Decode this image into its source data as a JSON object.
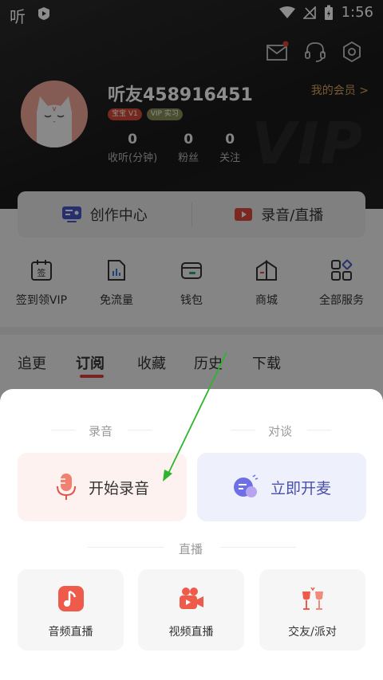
{
  "status_bar": {
    "app_glyph": "听",
    "time": "1:56"
  },
  "profile": {
    "username": "听友458916451",
    "badges": [
      "宝宝 V1",
      "VIP 实习"
    ],
    "member_link": "我的会员 >",
    "stats": [
      {
        "value": "0",
        "label": "收听(分钟)"
      },
      {
        "value": "0",
        "label": "粉丝"
      },
      {
        "value": "0",
        "label": "关注"
      }
    ]
  },
  "watermark": "VIP",
  "creator": {
    "left_label": "创作中心",
    "right_label": "录音/直播"
  },
  "quick_actions": [
    {
      "label": "签到领VIP",
      "icon": "sign-in-icon"
    },
    {
      "label": "免流量",
      "icon": "free-data-icon"
    },
    {
      "label": "钱包",
      "icon": "wallet-icon"
    },
    {
      "label": "商城",
      "icon": "mall-icon"
    },
    {
      "label": "全部服务",
      "icon": "all-services-icon"
    }
  ],
  "tabs": [
    "追更",
    "订阅",
    "收藏",
    "历史",
    "下载"
  ],
  "active_tab": "订阅",
  "sheet": {
    "record_section": "录音",
    "talk_section": "对谈",
    "record_button": "开始录音",
    "talk_button": "立即开麦",
    "live_section": "直播",
    "live_options": [
      {
        "label": "音频直播",
        "icon": "audio-live-icon"
      },
      {
        "label": "视频直播",
        "icon": "video-live-icon"
      },
      {
        "label": "交友/派对",
        "icon": "party-icon"
      }
    ]
  },
  "colors": {
    "accent": "#d8433a",
    "talk": "#4a4fa8",
    "annotation_arrow": "#2db52d",
    "member": "#d9a45c"
  }
}
